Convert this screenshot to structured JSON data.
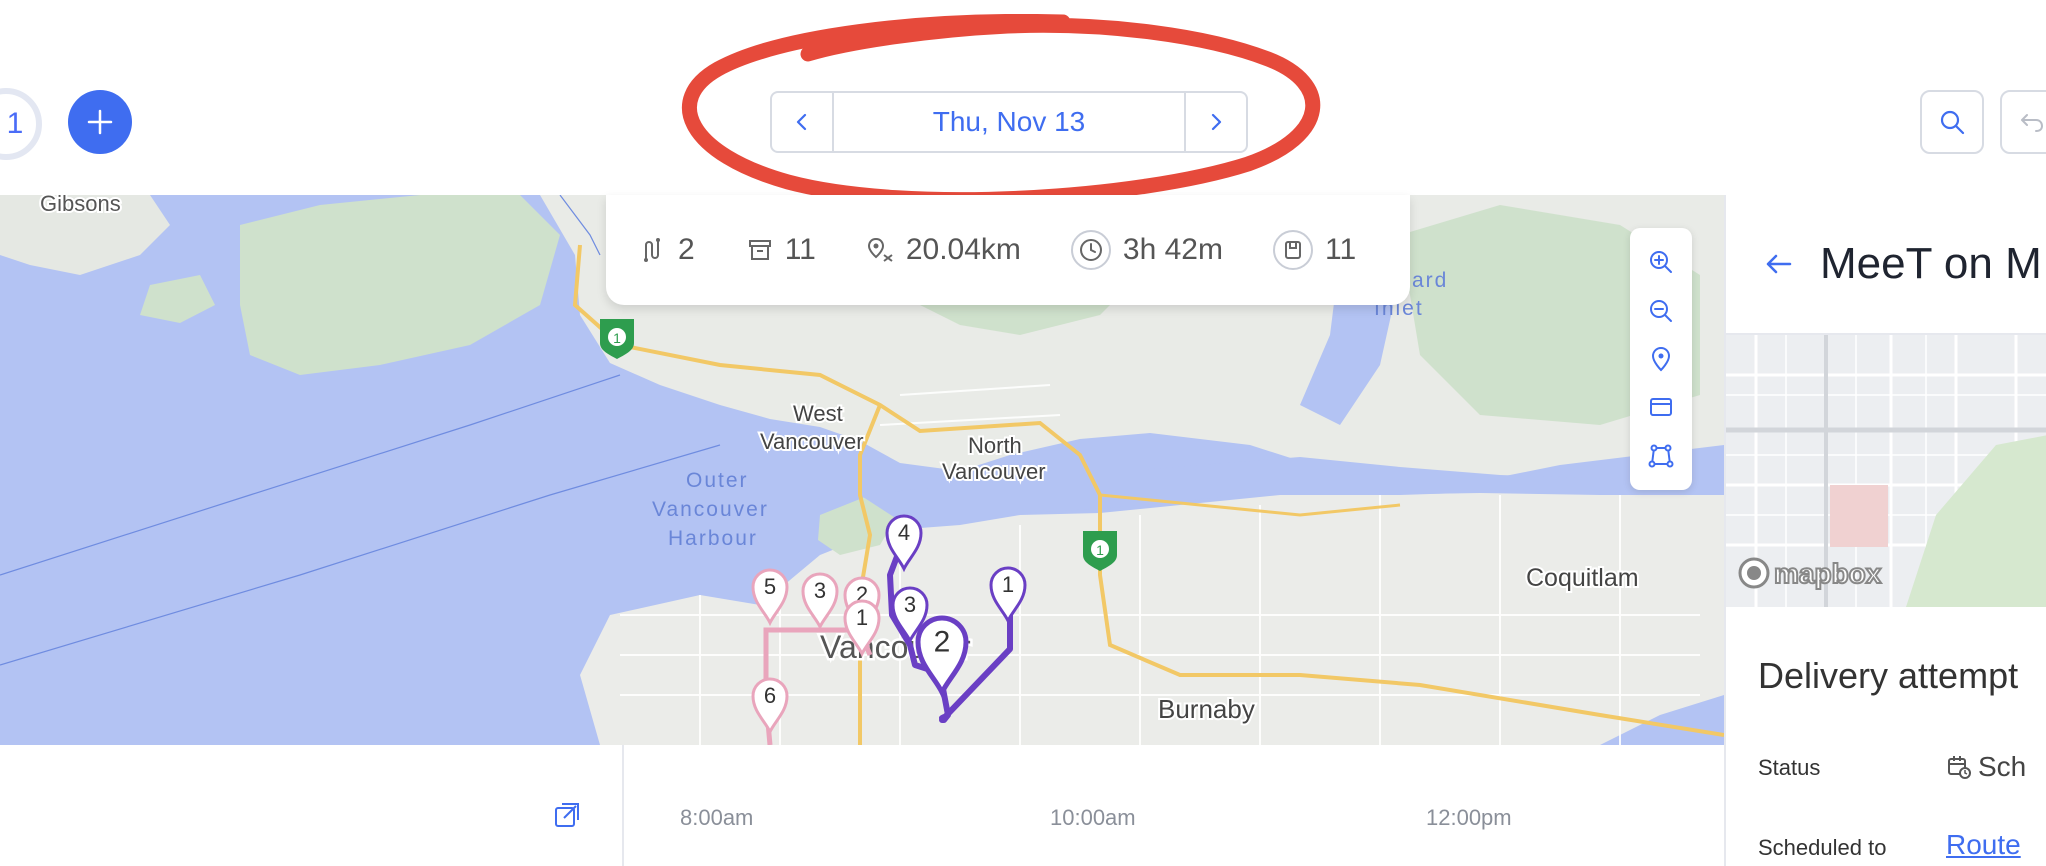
{
  "toolbar": {
    "left_partial_text": "1",
    "date_label": "Thu, Nov 13"
  },
  "stats": {
    "routes": "2",
    "stops": "11",
    "distance": "20.04km",
    "duration": "3h 42m",
    "orders": "11"
  },
  "map": {
    "labels": {
      "gibsons": "Gibsons",
      "west_vancouver_1": "West",
      "west_vancouver_2": "Vancouver",
      "north_vancouver_1": "North",
      "north_vancouver_2": "Vancouver",
      "outer_1": "Outer",
      "outer_2": "Vancouver",
      "outer_3": "Harbour",
      "inlet_1": "ard",
      "inlet_2": "Inlet",
      "coquitlam": "Coquitlam",
      "vancouver": "Vancouver",
      "burnaby": "Burnaby",
      "highway_1": "1",
      "highway_2": "1"
    },
    "pink_markers": [
      "5",
      "3",
      "2",
      "1",
      "6"
    ],
    "purple_markers": [
      "4",
      "3",
      "1",
      "2"
    ],
    "colors": {
      "water": "#b3c3f3",
      "land": "#e9ebe7",
      "park": "#cfe1cc",
      "highway": "#f2c866",
      "route_purple": "#6a3fc4",
      "route_pink": "#e9a5bc",
      "accent": "#3f6df0",
      "annotation": "#e64a3b"
    }
  },
  "panel": {
    "title": "MeeT on M",
    "attempt_title": "Delivery attempt",
    "status_label": "Status",
    "status_value": "Sch",
    "scheduled_label": "Scheduled to",
    "scheduled_value": "Route",
    "mapbox": "mapbox"
  },
  "timeline": {
    "ticks": [
      "8:00am",
      "10:00am",
      "12:00pm"
    ]
  }
}
